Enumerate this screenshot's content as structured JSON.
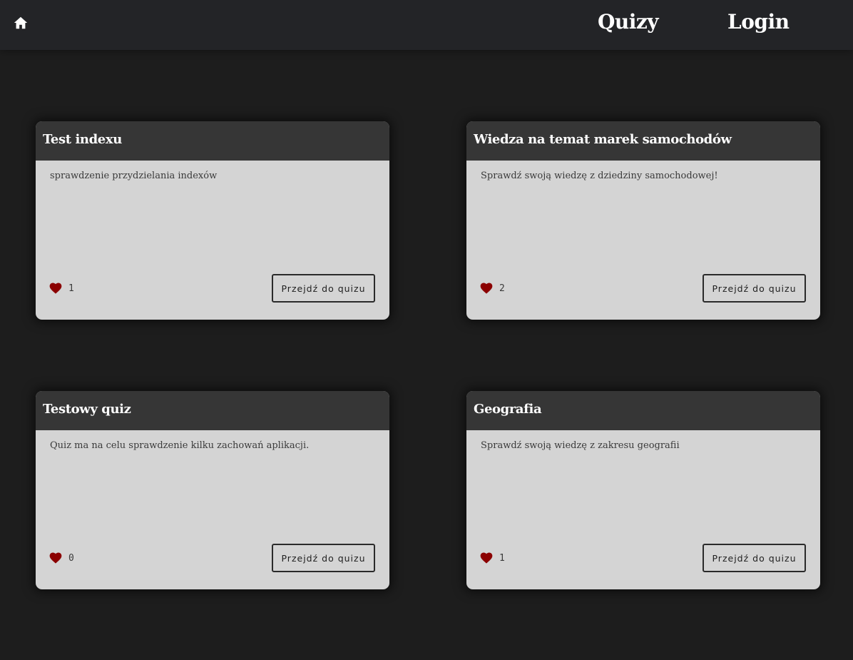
{
  "nav": {
    "home_icon": "home-icon",
    "links": [
      {
        "label": "Quizy"
      },
      {
        "label": "Login"
      }
    ]
  },
  "colors": {
    "background": "#1d1d1d",
    "navbar": "#232427",
    "card_body": "#d4d4d4",
    "card_header": "#363636",
    "heart": "#8b0000"
  },
  "quizzes": [
    {
      "title": "Test indexu",
      "description": "sprawdzenie przydzielania indexów",
      "likes": "1",
      "button_label": "Przejdź do quizu",
      "like_icon": "heart-icon"
    },
    {
      "title": "Wiedza na temat marek samochodów",
      "description": "Sprawdź swoją wiedzę z dziedziny samochodowej!",
      "likes": "2",
      "button_label": "Przejdź do quizu",
      "like_icon": "heart-icon"
    },
    {
      "title": "Testowy quiz",
      "description": "Quiz ma na celu sprawdzenie kilku zachowań aplikacji.",
      "likes": "0",
      "button_label": "Przejdź do quizu",
      "like_icon": "heart-icon"
    },
    {
      "title": "Geografia",
      "description": "Sprawdź swoją wiedzę z zakresu geografii",
      "likes": "1",
      "button_label": "Przejdź do quizu",
      "like_icon": "heart-icon"
    }
  ]
}
